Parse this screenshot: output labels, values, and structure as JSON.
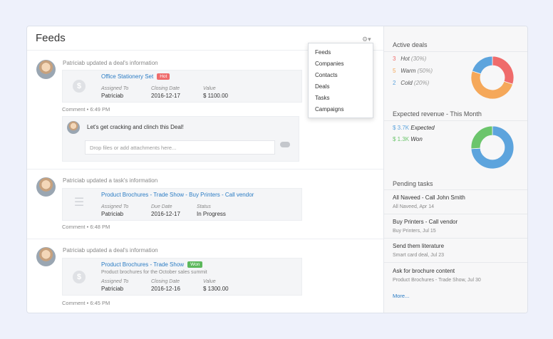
{
  "feeds": {
    "title": "Feeds",
    "items": [
      {
        "headline": "Patriciab updated a deal's information",
        "link": "Office Stationery Set",
        "badge": "Hot",
        "fields": [
          {
            "label": "Assigned To",
            "value": "Patriciab"
          },
          {
            "label": "Closing Date",
            "value": "2016-12-17"
          },
          {
            "label": "Value",
            "value": "$ 1100.00"
          }
        ],
        "comment": "Comment",
        "time": "6:49 PM"
      },
      {
        "headline": "Patriciab updated a task's information",
        "link": "Product Brochures - Trade Show - Buy Printers - Call vendor",
        "fields": [
          {
            "label": "Assigned To",
            "value": "Patriciab"
          },
          {
            "label": "Due Date",
            "value": "2016-12-17"
          },
          {
            "label": "Status",
            "value": "In Progress"
          }
        ],
        "comment": "Comment",
        "time": "6:48 PM"
      },
      {
        "headline": "Patriciab updated a deal's information",
        "link": "Product Brochures - Trade Show",
        "badge": "Won",
        "description": "Product brochures for the October sales summit",
        "fields": [
          {
            "label": "Assigned To",
            "value": "Patriciab"
          },
          {
            "label": "Closing Date",
            "value": "2016-12-16"
          },
          {
            "label": "Value",
            "value": "$ 1300.00"
          }
        ],
        "comment": "Comment",
        "time": "6:45 PM"
      }
    ],
    "comment_box": {
      "text": "Let's get cracking and clinch this Deal!",
      "placeholder": "Drop files or add attachments here..."
    }
  },
  "dropdown_menu": [
    "Feeds",
    "Companies",
    "Contacts",
    "Deals",
    "Tasks",
    "Campaigns"
  ],
  "sidebar": {
    "active_deals": {
      "title": "Active deals",
      "rows": [
        {
          "count": "3",
          "label": "Hot",
          "pct": "(30%)",
          "color": "#ef6b6b",
          "value": 30
        },
        {
          "count": "5",
          "label": "Warm",
          "pct": "(50%)",
          "color": "#f5a85a",
          "value": 50
        },
        {
          "count": "2",
          "label": "Cold",
          "pct": "(20%)",
          "color": "#5da4dd",
          "value": 20
        }
      ]
    },
    "expected_revenue": {
      "title": "Expected revenue - This Month",
      "rows": [
        {
          "amount": "$ 3.7K",
          "label": "Expected",
          "color": "#5da4dd",
          "value": 3.7
        },
        {
          "amount": "$ 1.3K",
          "label": "Won",
          "color": "#6cc56c",
          "value": 1.3
        }
      ]
    },
    "pending_tasks": {
      "title": "Pending tasks",
      "items": [
        {
          "title": "All Naveed - Call John Smith",
          "sub": "All Naveed,   Apr 14"
        },
        {
          "title": "Buy Printers - Call vendor",
          "sub": "Buy Printers,   Jul 15"
        },
        {
          "title": "Send them literature",
          "sub": "Smart card deal,   Jul 23"
        },
        {
          "title": "Ask for brochure content",
          "sub": "Product Brochures - Trade Show,   Jul 30"
        }
      ],
      "more": "More..."
    }
  }
}
